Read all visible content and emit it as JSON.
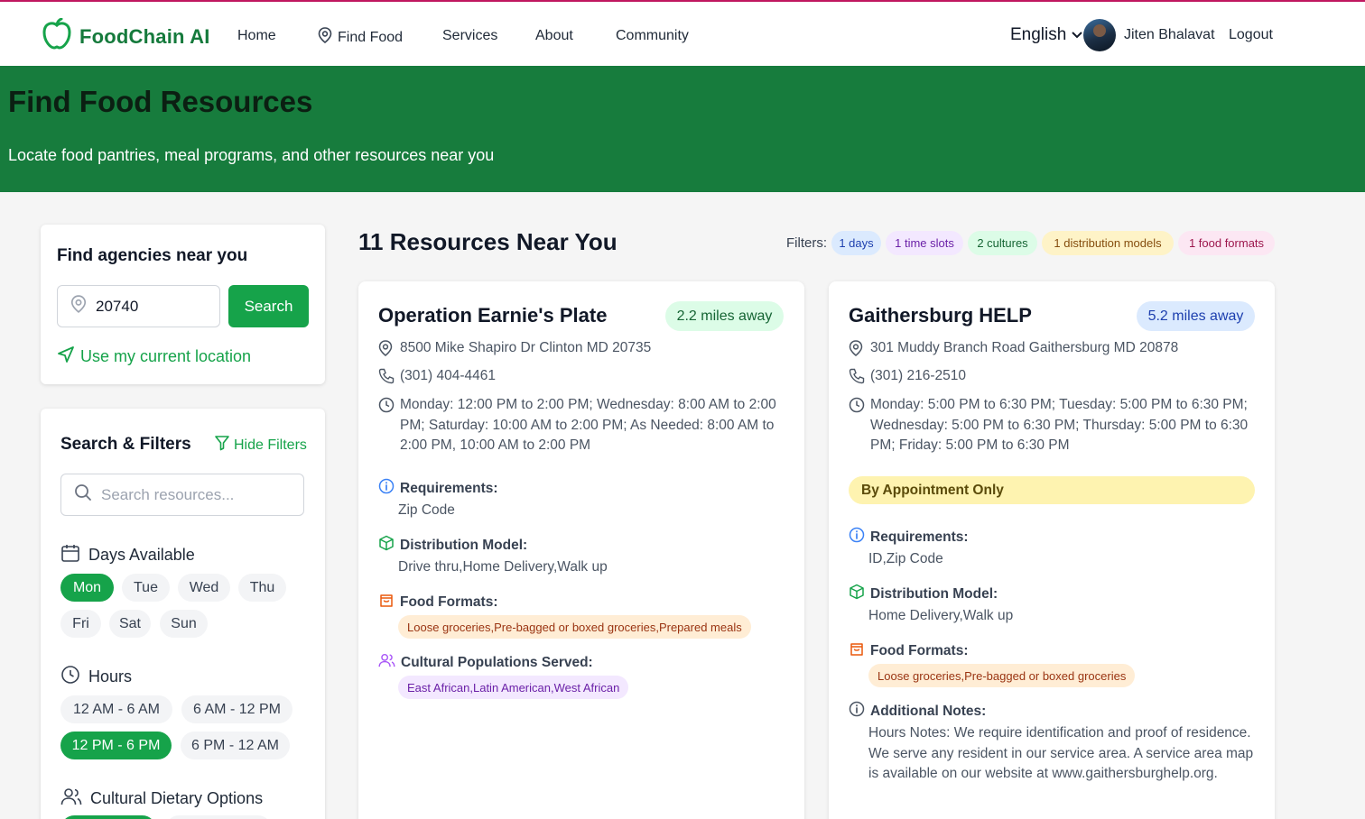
{
  "nav": {
    "brand": "FoodChain AI",
    "items": [
      "Home",
      "Find Food",
      "Services",
      "About",
      "Community"
    ],
    "language": "English",
    "user_name": "Jiten Bhalavat",
    "logout": "Logout"
  },
  "hero": {
    "title": "Find Food Resources",
    "subtitle": "Locate food pantries, meal programs, and other resources near you"
  },
  "agency": {
    "title": "Find agencies near you",
    "zip_value": "20740",
    "search_button": "Search",
    "use_location": "Use my current location"
  },
  "filters": {
    "title": "Search & Filters",
    "hide_label": "Hide Filters",
    "search_placeholder": "Search resources...",
    "days_heading": "Days Available",
    "days": [
      "Mon",
      "Tue",
      "Wed",
      "Thu",
      "Fri",
      "Sat",
      "Sun"
    ],
    "days_selected": [
      "Mon"
    ],
    "hours_heading": "Hours",
    "hours": [
      "12 AM - 6 AM",
      "6 AM - 12 PM",
      "12 PM - 6 PM",
      "6 PM - 12 AM"
    ],
    "hours_selected": [
      "12 PM - 6 PM"
    ],
    "cultural_heading": "Cultural Dietary Options"
  },
  "results": {
    "title": "11 Resources Near You",
    "filters_label": "Filters:",
    "active_filters": [
      "1 days",
      "1 time slots",
      "2 cultures",
      "1 distribution models",
      "1 food formats"
    ]
  },
  "cards": [
    {
      "name": "Operation Earnie's Plate",
      "distance": "2.2 miles away",
      "address": "8500 Mike Shapiro Dr Clinton MD 20735",
      "phone": "(301) 404-4461",
      "hours": "Monday: 12:00 PM to 2:00 PM; Wednesday: 8:00 AM to 2:00 PM; Saturday: 10:00 AM to 2:00 PM; As Needed: 8:00 AM to 2:00 PM, 10:00 AM to 2:00 PM",
      "requirements_label": "Requirements:",
      "requirements": "Zip Code",
      "distribution_label": "Distribution Model:",
      "distribution": "Drive thru,Home Delivery,Walk up",
      "formats_label": "Food Formats:",
      "formats": "Loose groceries,Pre-bagged or boxed groceries,Prepared meals",
      "cultural_label": "Cultural Populations Served:",
      "cultural": "East African,Latin American,West African"
    },
    {
      "name": "Gaithersburg HELP",
      "distance": "5.2 miles away",
      "address": "301 Muddy Branch Road Gaithersburg MD 20878",
      "phone": "(301) 216-2510",
      "hours": "Monday: 5:00 PM to 6:30 PM; Tuesday: 5:00 PM to 6:30 PM; Wednesday: 5:00 PM to 6:30 PM; Thursday: 5:00 PM to 6:30 PM; Friday: 5:00 PM to 6:30 PM",
      "appointment": "By Appointment Only",
      "requirements_label": "Requirements:",
      "requirements": "ID,Zip Code",
      "distribution_label": "Distribution Model:",
      "distribution": "Home Delivery,Walk up",
      "formats_label": "Food Formats:",
      "formats": "Loose groceries,Pre-bagged or boxed groceries",
      "notes_label": "Additional Notes:",
      "notes": "Hours Notes: We require identification and proof of residence. We serve any resident in our service area. A service area map is available on our website at www.gaithersburghelp.org."
    }
  ],
  "colors": {
    "brand_green": "#177c3d",
    "accent_green": "#16a34a"
  }
}
